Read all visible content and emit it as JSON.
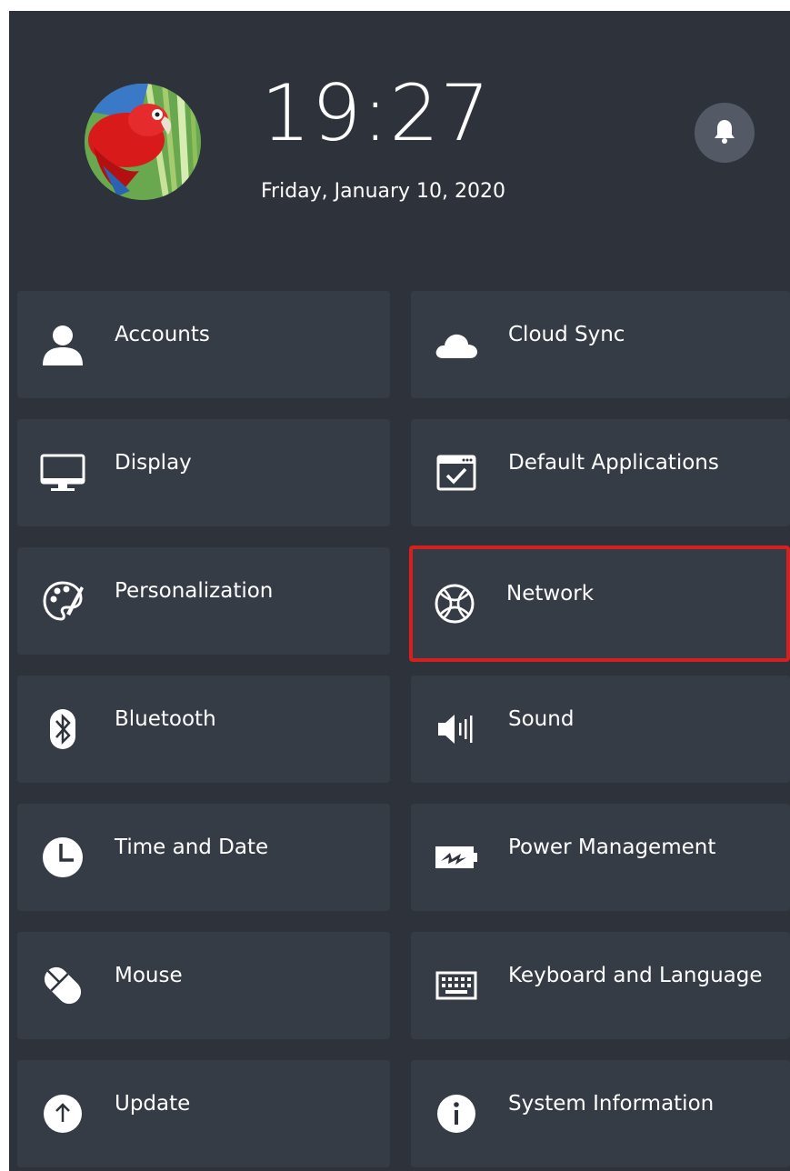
{
  "header": {
    "time": "19:27",
    "date": "Friday, January 10, 2020",
    "avatar_icon": "user-avatar-parrot",
    "notification_icon": "bell-icon"
  },
  "settings": [
    {
      "label": "Accounts",
      "icon": "user-icon"
    },
    {
      "label": "Cloud Sync",
      "icon": "cloud-icon"
    },
    {
      "label": "Display",
      "icon": "monitor-icon"
    },
    {
      "label": "Default Applications",
      "icon": "default-apps-icon"
    },
    {
      "label": "Personalization",
      "icon": "palette-icon"
    },
    {
      "label": "Network",
      "icon": "globe-icon",
      "highlighted": true
    },
    {
      "label": "Bluetooth",
      "icon": "bluetooth-icon"
    },
    {
      "label": "Sound",
      "icon": "speaker-icon"
    },
    {
      "label": "Time and Date",
      "icon": "clock-icon"
    },
    {
      "label": "Power Management",
      "icon": "battery-icon"
    },
    {
      "label": "Mouse",
      "icon": "mouse-icon"
    },
    {
      "label": "Keyboard and Language",
      "icon": "keyboard-icon"
    },
    {
      "label": "Update",
      "icon": "update-arrow-icon"
    },
    {
      "label": "System Information",
      "icon": "info-icon"
    }
  ],
  "colors": {
    "background": "#2e333b",
    "tile": "#363c45",
    "highlight": "#d61f1f",
    "bell_button": "#535a66"
  }
}
